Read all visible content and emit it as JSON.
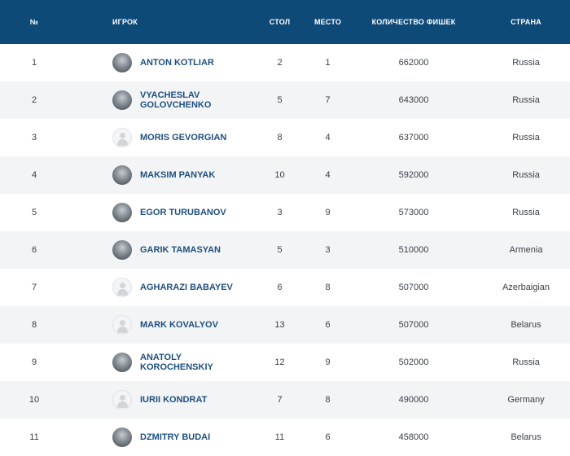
{
  "table": {
    "headers": {
      "num": "№",
      "player": "ИГРОК",
      "table": "СТОЛ",
      "place": "МЕСТО",
      "chips": "КОЛИЧЕСТВО ФИШЕК",
      "country": "СТРАНА"
    },
    "rows": [
      {
        "num": "1",
        "name": "ANTON KOTLIAR",
        "avatar": "photo",
        "table": "2",
        "place": "1",
        "chips": "662000",
        "country": "Russia"
      },
      {
        "num": "2",
        "name": "VYACHESLAV GOLOVCHENKO",
        "avatar": "photo",
        "table": "5",
        "place": "7",
        "chips": "643000",
        "country": "Russia"
      },
      {
        "num": "3",
        "name": "MORIS GEVORGIAN",
        "avatar": "placeholder",
        "table": "8",
        "place": "4",
        "chips": "637000",
        "country": "Russia"
      },
      {
        "num": "4",
        "name": "MAKSIM PANYAK",
        "avatar": "photo",
        "table": "10",
        "place": "4",
        "chips": "592000",
        "country": "Russia"
      },
      {
        "num": "5",
        "name": "EGOR TURUBANOV",
        "avatar": "photo",
        "table": "3",
        "place": "9",
        "chips": "573000",
        "country": "Russia"
      },
      {
        "num": "6",
        "name": "GARIK TAMASYAN",
        "avatar": "photo",
        "table": "5",
        "place": "3",
        "chips": "510000",
        "country": "Armenia"
      },
      {
        "num": "7",
        "name": "AGHARAZI BABAYEV",
        "avatar": "placeholder",
        "table": "6",
        "place": "8",
        "chips": "507000",
        "country": "Azerbaigian"
      },
      {
        "num": "8",
        "name": "MARK KOVALYOV",
        "avatar": "placeholder",
        "table": "13",
        "place": "6",
        "chips": "507000",
        "country": "Belarus"
      },
      {
        "num": "9",
        "name": "ANATOLY KOROCHENSKIY",
        "avatar": "photo",
        "table": "12",
        "place": "9",
        "chips": "502000",
        "country": "Russia"
      },
      {
        "num": "10",
        "name": "IURII KONDRAT",
        "avatar": "placeholder",
        "table": "7",
        "place": "8",
        "chips": "490000",
        "country": "Germany"
      },
      {
        "num": "11",
        "name": "DZMITRY BUDAI",
        "avatar": "photo",
        "table": "11",
        "place": "6",
        "chips": "458000",
        "country": "Belarus"
      }
    ]
  },
  "colors": {
    "header_bg": "#0e4a78",
    "row_alt_bg": "#f3f4f6",
    "name_text": "#1f4f7f"
  }
}
